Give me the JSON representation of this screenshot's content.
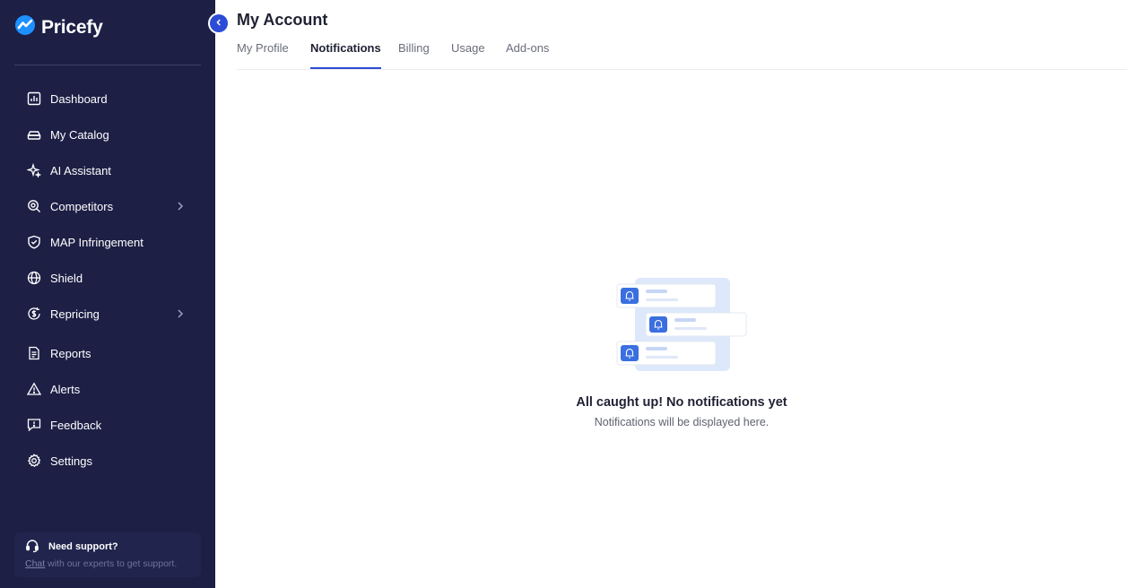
{
  "app": {
    "name": "Pricefy"
  },
  "sidebar": {
    "items": [
      {
        "label": "Dashboard",
        "icon": "bar-chart-icon"
      },
      {
        "label": "My Catalog",
        "icon": "catalog-icon"
      },
      {
        "label": "AI Assistant",
        "icon": "sparkles-icon"
      },
      {
        "label": "Competitors",
        "icon": "search-icon",
        "expandable": true
      },
      {
        "label": "MAP Infringement",
        "icon": "shield-check-icon"
      },
      {
        "label": "Shield",
        "icon": "globe-icon"
      },
      {
        "label": "Repricing",
        "icon": "dollar-cycle-icon",
        "expandable": true
      },
      {
        "label": "Reports",
        "icon": "document-icon"
      },
      {
        "label": "Alerts",
        "icon": "warning-icon"
      },
      {
        "label": "Feedback",
        "icon": "message-alert-icon"
      },
      {
        "label": "Settings",
        "icon": "gear-icon"
      }
    ],
    "support": {
      "title": "Need support?",
      "link": "Chat",
      "text": " with our experts to get support."
    }
  },
  "main": {
    "title": "My Account",
    "tabs": [
      {
        "label": "My Profile",
        "active": false
      },
      {
        "label": "Notifications",
        "active": true
      },
      {
        "label": "Billing",
        "active": false
      },
      {
        "label": "Usage",
        "active": false
      },
      {
        "label": "Add-ons",
        "active": false
      }
    ],
    "empty_state": {
      "title": "All caught up! No notifications yet",
      "subtitle": "Notifications will be displayed here."
    }
  },
  "colors": {
    "sidebar_bg": "#1d1f45",
    "accent": "#2c4bd6",
    "logo_blue": "#1e90ff",
    "bell_blue": "#3b6fe0"
  }
}
